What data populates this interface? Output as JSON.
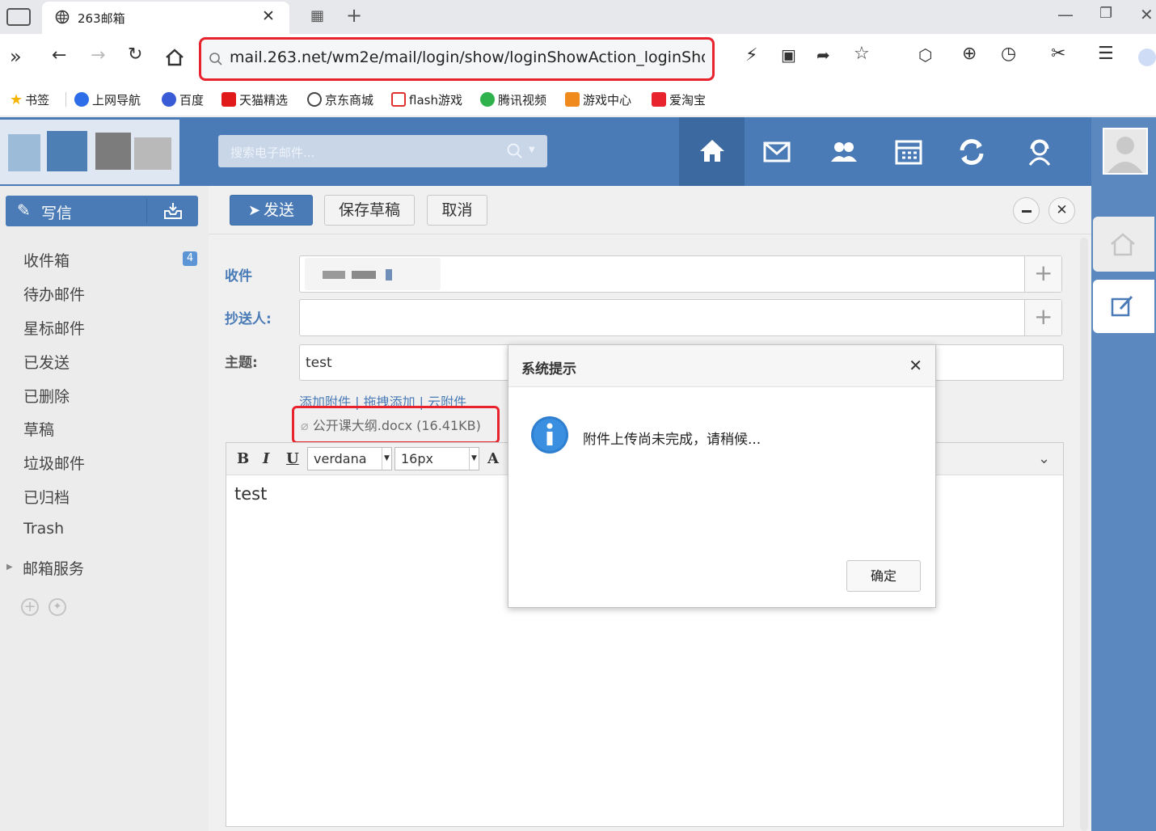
{
  "browser": {
    "tab_title": "263邮箱",
    "url": "mail.263.net/wm2e/mail/login/show/loginShowAction_loginShow.",
    "bookmarks": [
      "书签",
      "上网导航",
      "百度",
      "天猫精选",
      "京东商城",
      "flash游戏",
      "腾讯视频",
      "游戏中心",
      "爱淘宝"
    ]
  },
  "header": {
    "search_placeholder": "搜索电子邮件..."
  },
  "sidebar": {
    "compose_label": "写信",
    "inbox_badge": "4",
    "folders": [
      "收件箱",
      "待办邮件",
      "星标邮件",
      "已发送",
      "已删除",
      "草稿",
      "垃圾邮件",
      "已归档",
      "Trash"
    ],
    "mail_service": "邮箱服务"
  },
  "actions": {
    "send": "发送",
    "save_draft": "保存草稿",
    "cancel": "取消"
  },
  "compose": {
    "to_label": "收件",
    "cc_label": "抄送人:",
    "subject_label": "主题:",
    "subject_value": "test",
    "attach_links": "添加附件  |  拖拽添加  |  云附件",
    "attachment": "公开课大纲.docx (16.41KB)",
    "font_family": "verdana",
    "font_size": "16px",
    "body": "test"
  },
  "dialog": {
    "title": "系统提示",
    "message": "附件上传尚未完成，请稍候...",
    "ok": "确定"
  },
  "colors": {
    "header_blue": "#4a7bb6",
    "highlight_red": "#e8232d"
  }
}
